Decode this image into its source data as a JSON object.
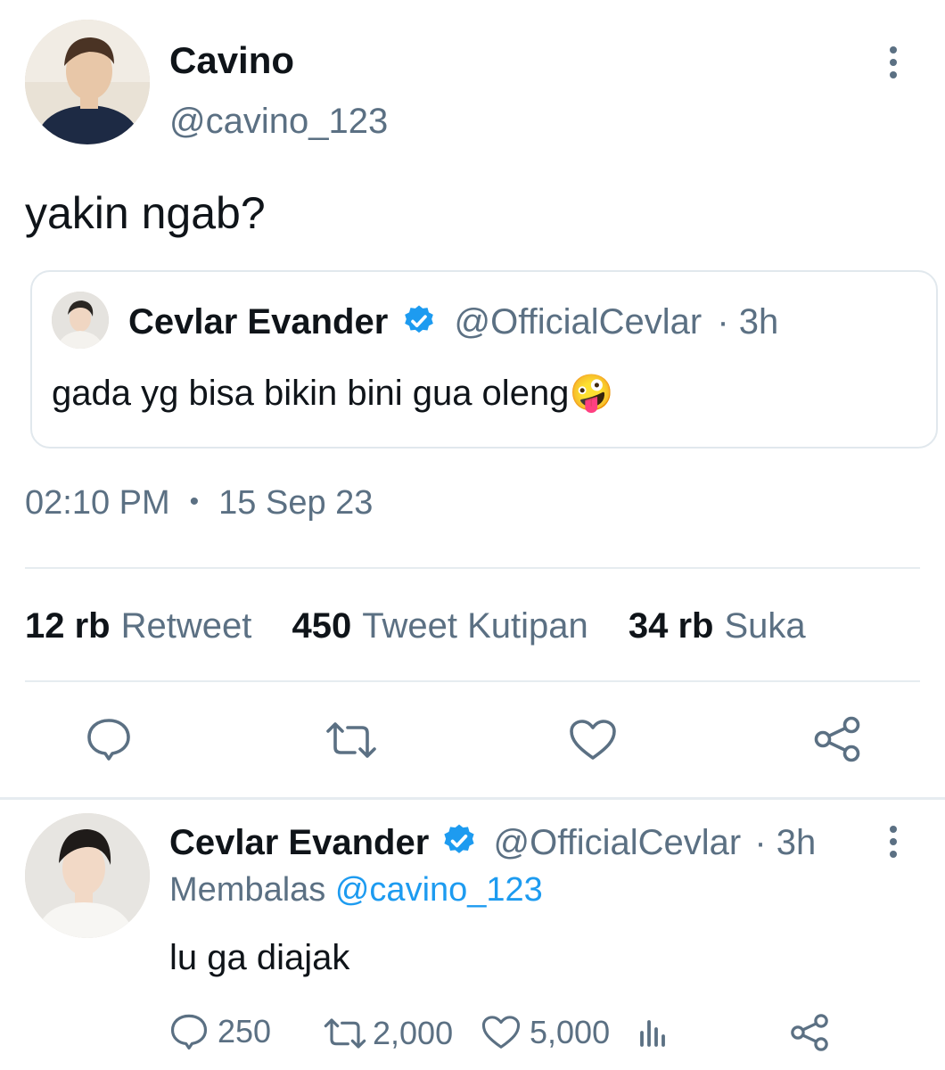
{
  "main_tweet": {
    "author_name": "Cavino",
    "author_handle": "@cavino_123",
    "text": "yakin ngab?",
    "quoted": {
      "author_name": "Cevlar Evander",
      "author_handle": "@OfficialCevlar",
      "time_ago": "· 3h",
      "text": "gada yg bisa bikin bini gua oleng",
      "emoji": "🤪"
    },
    "time": "02:10 PM",
    "separator": "•",
    "date": "15 Sep 23",
    "stats": [
      {
        "count": "12 rb",
        "label": "Retweet"
      },
      {
        "count": "450",
        "label": "Tweet Kutipan"
      },
      {
        "count": "34 rb",
        "label": "Suka"
      }
    ],
    "actions": [
      "reply-icon",
      "retweet-icon",
      "like-icon",
      "share-icon"
    ]
  },
  "reply_tweet": {
    "author_name": "Cevlar Evander",
    "author_handle": "@OfficialCevlar",
    "time_ago": "· 3h",
    "replying_prefix": "Membalas",
    "replying_to": "@cavino_123",
    "text": "lu ga diajak",
    "counts": {
      "replies": "250",
      "retweets": "2,000",
      "likes": "5,000"
    }
  },
  "colors": {
    "text": "#0f1419",
    "secondary": "#5b7083",
    "accent": "#1d9bf0",
    "border": "#e1e8ed"
  }
}
